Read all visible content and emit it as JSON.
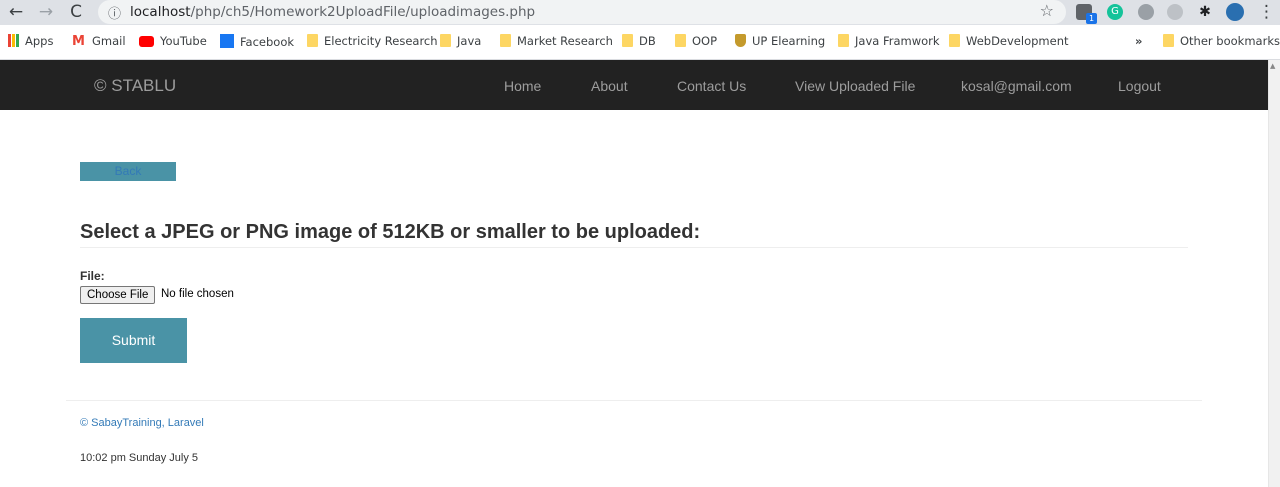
{
  "browser": {
    "url_host": "localhost",
    "url_path": "/php/ch5/Homework2UploadFile/uploadimages.php",
    "bookmarks": [
      {
        "label": "Apps",
        "icon": "apps-grid-icon"
      },
      {
        "label": "Gmail",
        "icon": "gmail-icon"
      },
      {
        "label": "YouTube",
        "icon": "youtube-icon"
      },
      {
        "label": "Facebook",
        "icon": "facebook-icon"
      },
      {
        "label": "Electricity Research",
        "icon": "folder-icon"
      },
      {
        "label": "Java",
        "icon": "folder-icon"
      },
      {
        "label": "Market Research",
        "icon": "folder-icon"
      },
      {
        "label": "DB",
        "icon": "folder-icon"
      },
      {
        "label": "OOP",
        "icon": "folder-icon"
      },
      {
        "label": "UP Elearning",
        "icon": "shield-icon"
      },
      {
        "label": "Java Framwork",
        "icon": "folder-icon"
      },
      {
        "label": "WebDevelopment",
        "icon": "folder-icon"
      }
    ],
    "more_bookmarks": "»",
    "other_bookmarks": "Other bookmarks",
    "extension_badge": "1"
  },
  "navbar": {
    "brand": "© STABLU",
    "links": [
      "Home",
      "About",
      "Contact Us",
      "View Uploaded File",
      "kosal@gmail.com",
      "Logout"
    ]
  },
  "main": {
    "back_label": "Back",
    "heading": "Select a JPEG or PNG image of 512KB or smaller to be uploaded:",
    "file_label": "File:",
    "choose_file": "Choose File",
    "no_file": "No file chosen",
    "submit_label": "Submit"
  },
  "footer": {
    "credit": "© SabayTraining, Laravel",
    "datetime": "10:02 pm Sunday July 5"
  },
  "colors": {
    "navbar_bg": "#222222",
    "accent": "#4a93a6",
    "link": "#337ab7"
  }
}
